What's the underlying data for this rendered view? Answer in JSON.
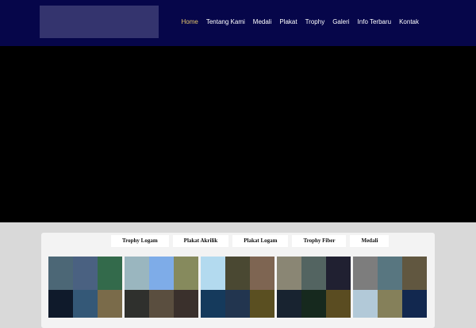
{
  "nav": {
    "items": [
      {
        "label": "Home",
        "active": true
      },
      {
        "label": "Tentang Kami",
        "active": false
      },
      {
        "label": "Medali",
        "active": false
      },
      {
        "label": "Plakat",
        "active": false
      },
      {
        "label": "Trophy",
        "active": false
      },
      {
        "label": "Galeri",
        "active": false
      },
      {
        "label": "Info Terbaru",
        "active": false
      },
      {
        "label": "Kontak",
        "active": false
      }
    ]
  },
  "tabs": [
    {
      "label": "Trophy Logam",
      "active": true
    },
    {
      "label": "Plakat Akrilik",
      "active": false
    },
    {
      "label": "Plakat Logam",
      "active": false
    },
    {
      "label": "Trophy Fiber",
      "active": false
    },
    {
      "label": "Medali",
      "active": false
    }
  ],
  "gallery": {
    "groups": [
      {
        "colors": [
          "#4c6776",
          "#4a6181",
          "#336a4b",
          "#0f1a2b",
          "#345877",
          "#7a6b4a"
        ]
      },
      {
        "colors": [
          "#9ab6bf",
          "#7eace8",
          "#868a5d",
          "#2f302d",
          "#5a4e3f",
          "#3a302c"
        ]
      },
      {
        "colors": [
          "#b3daef",
          "#4a4832",
          "#7e6552",
          "#153a5c",
          "#22354f",
          "#5a4f21"
        ]
      },
      {
        "colors": [
          "#8a8674",
          "#536461",
          "#202031",
          "#182330",
          "#16291e",
          "#5a4c21"
        ]
      },
      {
        "colors": [
          "#7d7d7d",
          "#587680",
          "#615740",
          "#b2c9d8",
          "#85805a",
          "#12284f"
        ]
      }
    ]
  },
  "colors": {
    "header_bg": "#06064a",
    "logo_placeholder": "#34346e",
    "hero_bg": "#000000",
    "active_nav": "#e7c66b"
  }
}
